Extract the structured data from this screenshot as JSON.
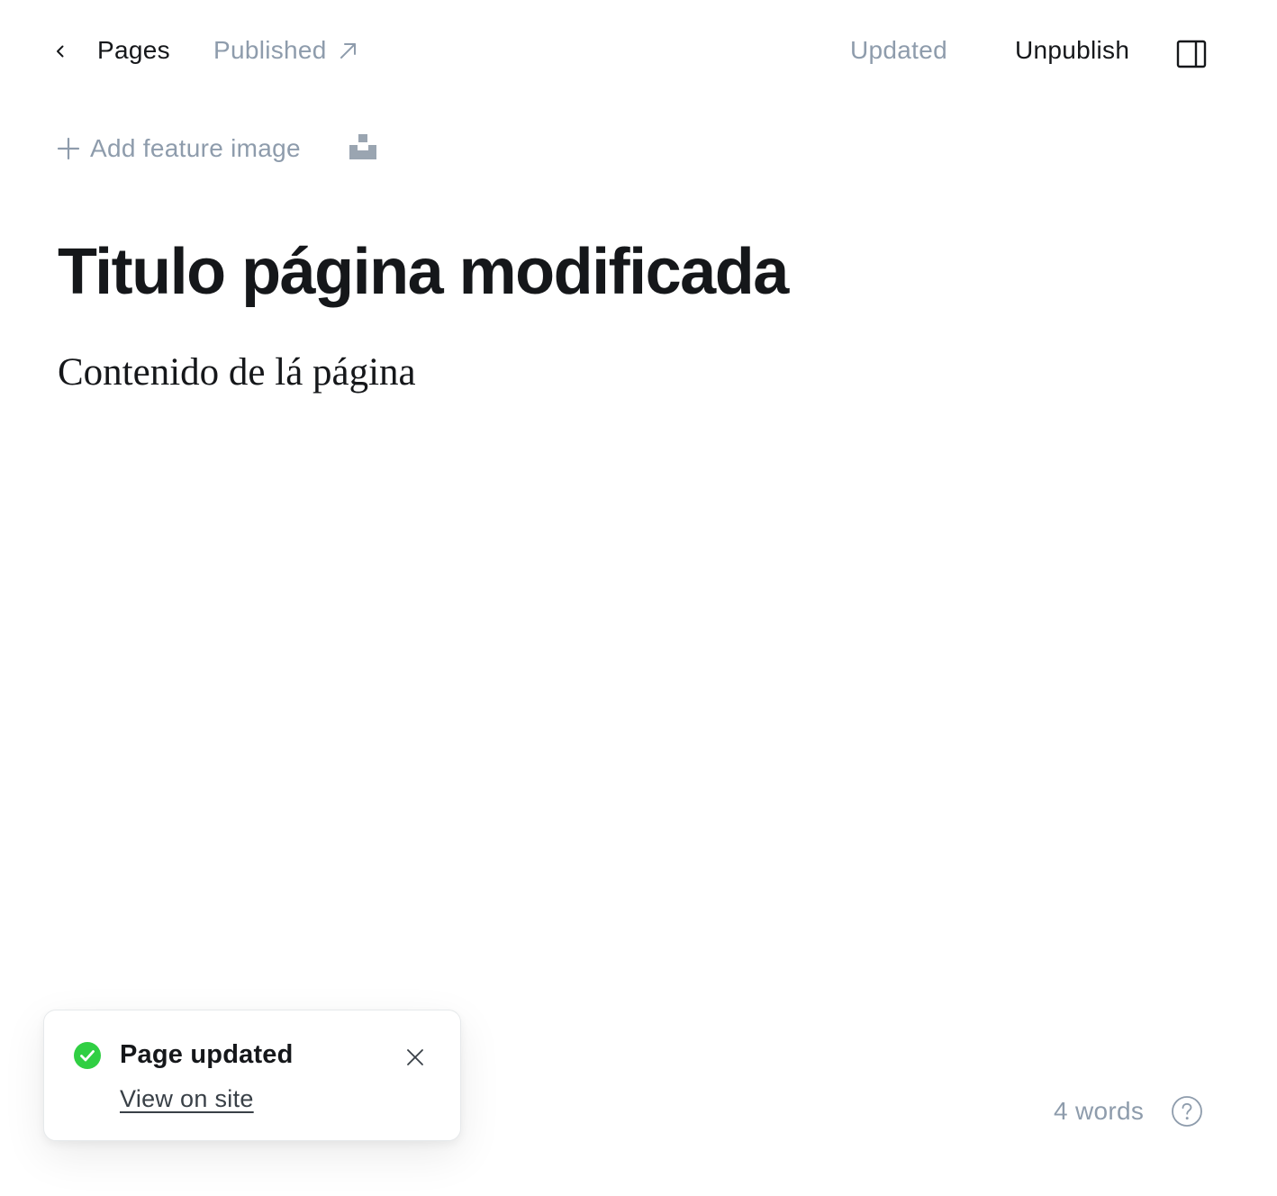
{
  "header": {
    "back_icon": "chevron-left-icon",
    "breadcrumb_parent": "Pages",
    "status": "Published",
    "status_icon": "arrow-up-right-icon",
    "save_status": "Updated",
    "unpublish_label": "Unpublish",
    "sidebar_toggle_icon": "sidebar-panel-icon"
  },
  "editor": {
    "feature_image_label": "Add feature image",
    "feature_image_icon": "plus-icon",
    "unsplash_icon": "unsplash-icon",
    "title": "Titulo página modificada",
    "body": "Contenido de lá página"
  },
  "footer": {
    "word_count": "4 words",
    "help_icon": "question-circle-icon"
  },
  "toast": {
    "icon": "check-circle-icon",
    "title": "Page updated",
    "link_label": "View on site",
    "close_icon": "close-icon"
  },
  "colors": {
    "text": "#15171a",
    "muted": "#8e9cac",
    "success": "#30cf43"
  }
}
